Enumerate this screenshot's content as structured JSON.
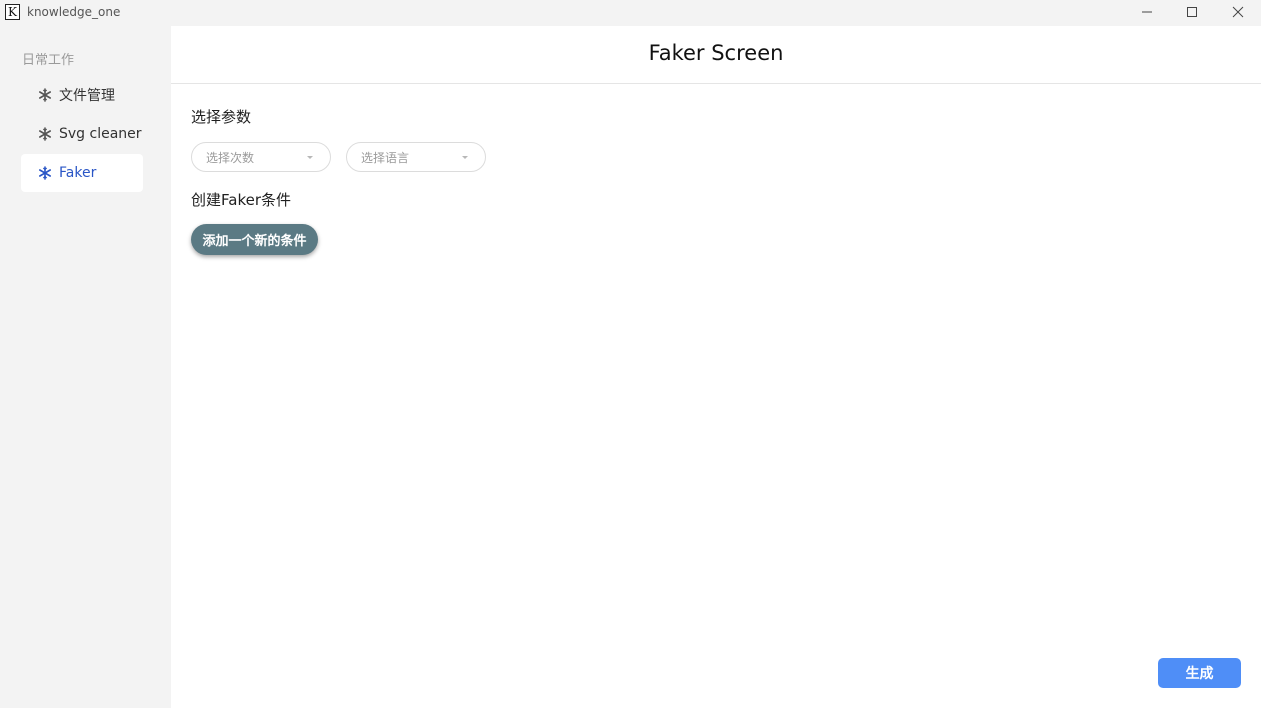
{
  "window": {
    "logo_letter": "K",
    "title": "knowledge_one",
    "icons": [
      "minimize-icon",
      "maximize-icon",
      "close-icon"
    ]
  },
  "sidebar": {
    "section_title": "日常工作",
    "items": [
      {
        "label": "文件管理",
        "icon": "snowflake-icon",
        "active": false
      },
      {
        "label": "Svg cleaner",
        "icon": "snowflake-icon",
        "active": false
      },
      {
        "label": "Faker",
        "icon": "snowflake-icon",
        "active": true
      }
    ]
  },
  "main": {
    "title": "Faker Screen",
    "params_label": "选择参数",
    "count_select": {
      "placeholder": "选择次数"
    },
    "lang_select": {
      "placeholder": "选择语言"
    },
    "conditions_label": "创建Faker条件",
    "add_condition_label": "添加一个新的条件",
    "generate_label": "生成"
  },
  "colors": {
    "active_nav": "#2a56c6",
    "add_button": "#5b7a84",
    "generate_button": "#4f8ef7"
  }
}
